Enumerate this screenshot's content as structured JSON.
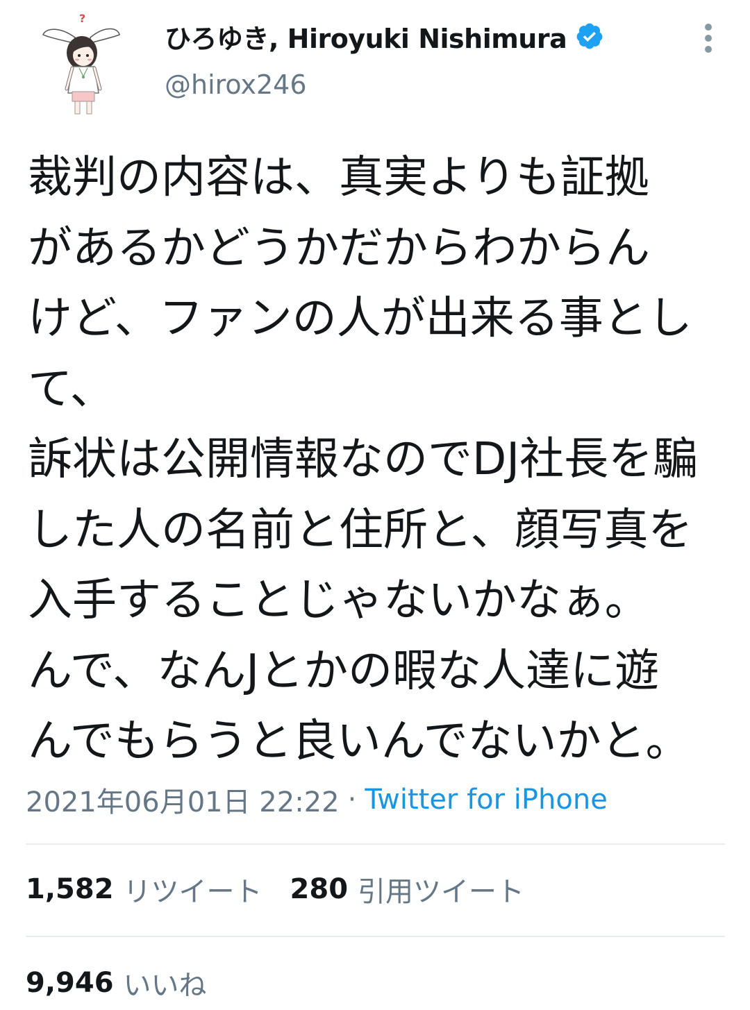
{
  "author": {
    "display_name": "ひろゆき, Hiroyuki Nishimura",
    "handle": "@hirox246",
    "verified": true,
    "avatar_icon": "rabbit-ear-girl-avatar"
  },
  "menu": {
    "icon": "vertical-ellipsis-icon"
  },
  "tweet": {
    "lines": [
      "裁判の内容は、真実よりも証拠",
      "があるかどうかだからわからん",
      "けど、ファンの人が出来る事とし",
      "て、",
      "訴状は公開情報なのでDJ社長を騙",
      "した人の名前と住所と、顔写真を",
      "入手することじゃないかなぁ。",
      "んで、なんJとかの暇な人達に遊",
      "んでもらうと良いんでないかと。"
    ]
  },
  "meta": {
    "timestamp": "2021年06月01日 22:22",
    "separator": "·",
    "source": "Twitter for iPhone"
  },
  "stats": {
    "retweets": {
      "count": "1,582",
      "label": "リツイート"
    },
    "quotes": {
      "count": "280",
      "label": "引用ツイート"
    },
    "likes": {
      "count": "9,946",
      "label": "いいね"
    }
  },
  "colors": {
    "text": "#14171a",
    "secondary": "#657786",
    "link": "#1b95e0",
    "verified": "#1da1f2",
    "divider": "#e6ecf0"
  }
}
